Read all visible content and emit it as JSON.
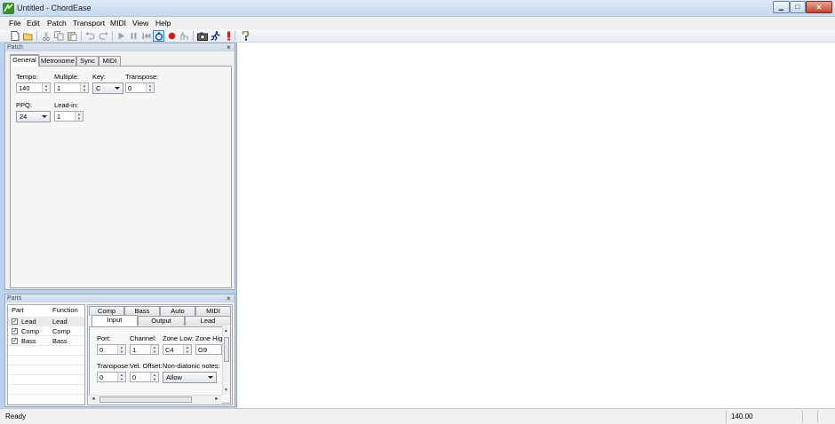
{
  "window": {
    "title": "Untitled - ChordEase",
    "controls": {
      "minimize": "▁",
      "maximize": "□",
      "close": "✕"
    }
  },
  "menu": [
    "File",
    "Edit",
    "Patch",
    "Transport",
    "MIDI",
    "View",
    "Help"
  ],
  "toolbar": {
    "icons": [
      "new-icon",
      "open-icon",
      "cut-icon",
      "copy-icon",
      "paste-icon",
      "undo-icon",
      "redo-icon",
      "play-icon",
      "pause-icon",
      "rewind-icon",
      "repeat-icon",
      "record-icon",
      "tap-icon",
      "snapshot-icon",
      "runner-icon",
      "panic-icon",
      "help-icon"
    ]
  },
  "patch_panel": {
    "title": "Patch",
    "close": "×",
    "tabs": [
      "General",
      "Metronome",
      "Sync",
      "MIDI"
    ],
    "selected_tab": "General",
    "fields": {
      "tempo_label": "Tempo:",
      "tempo_value": "140",
      "multiple_label": "Multiple:",
      "multiple_value": "1",
      "key_label": "Key:",
      "key_value": "C",
      "transpose_label": "Transpose:",
      "transpose_value": "0",
      "ppq_label": "PPQ:",
      "ppq_value": "24",
      "leadin_label": "Lead-in:",
      "leadin_value": "1"
    }
  },
  "parts_panel": {
    "title": "Parts",
    "close": "×",
    "columns": [
      "Part",
      "Function"
    ],
    "rows": [
      {
        "part": "Lead",
        "function": "Lead",
        "checked": "✓"
      },
      {
        "part": "Comp",
        "function": "Comp",
        "checked": "✓"
      },
      {
        "part": "Bass",
        "function": "Bass",
        "checked": "✓"
      }
    ],
    "tabs_row1": [
      "Comp",
      "Bass",
      "Auto",
      "MIDI"
    ],
    "tabs_row2": [
      "Input",
      "Output",
      "Lead"
    ],
    "selected_tab": "Input",
    "fields": {
      "port_label": "Port:",
      "port_value": "0",
      "channel_label": "Channel:",
      "channel_value": "1",
      "zone_low_label": "Zone Low:",
      "zone_low_value": "C4",
      "zone_high_label": "Zone Hig",
      "zone_high_value": "G9",
      "transpose_label": "Transpose:",
      "transpose_value": "0",
      "vel_offset_label": "Vel. Offset:",
      "vel_offset_value": "0",
      "nondiatonic_label": "Non-diatonic notes:",
      "nondiatonic_value": "Allow"
    }
  },
  "status": {
    "text": "Ready",
    "tempo": "140.00"
  }
}
